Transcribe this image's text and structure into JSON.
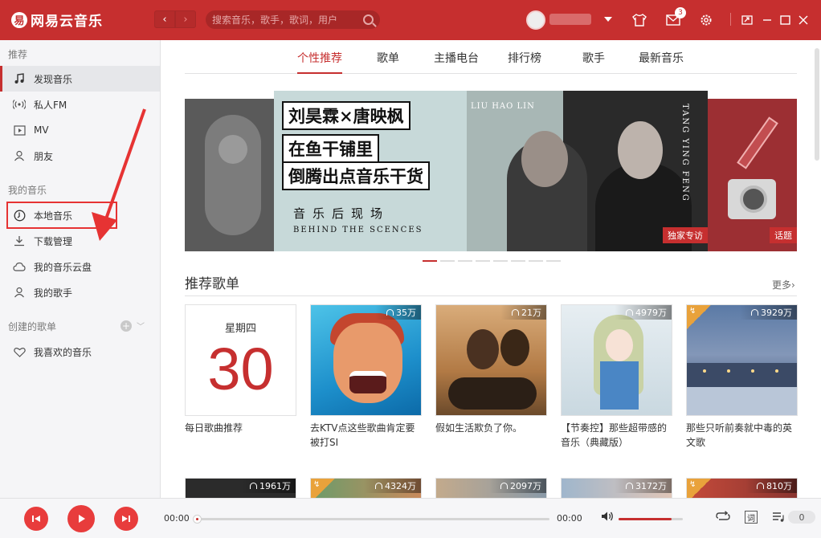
{
  "app": {
    "logo_mark": "易",
    "title": "网易云音乐"
  },
  "header": {
    "back_glyph": "‹",
    "forward_glyph": "›",
    "search_placeholder": "搜索音乐，歌手，歌词，用户",
    "mail_badge": "3",
    "icons": [
      "user-avatar",
      "caret-down-icon",
      "skin-icon",
      "mail-icon",
      "gear-icon",
      "mini-mode-icon",
      "minimize-icon",
      "maximize-icon",
      "close-icon"
    ],
    "accent_color": "#c62f2f"
  },
  "sidebar": {
    "sections": {
      "recommend": "推荐",
      "my_music": "我的音乐",
      "created_playlists": "创建的歌单"
    },
    "recommend_items": [
      {
        "label": "发现音乐",
        "icon": "music-note-icon",
        "active": true
      },
      {
        "label": "私人FM",
        "icon": "radio-icon",
        "active": false
      },
      {
        "label": "MV",
        "icon": "video-icon",
        "active": false
      },
      {
        "label": "朋友",
        "icon": "friends-icon",
        "active": false
      }
    ],
    "my_music_items": [
      {
        "label": "本地音乐",
        "icon": "local-music-icon"
      },
      {
        "label": "下载管理",
        "icon": "download-icon"
      },
      {
        "label": "我的音乐云盘",
        "icon": "cloud-icon"
      },
      {
        "label": "我的歌手",
        "icon": "singer-icon"
      }
    ],
    "playlist_items": [
      {
        "label": "我喜欢的音乐",
        "icon": "heart-icon"
      }
    ]
  },
  "tabs": [
    {
      "label": "个性推荐",
      "active": true
    },
    {
      "label": "歌单",
      "active": false
    },
    {
      "label": "主播电台",
      "active": false
    },
    {
      "label": "排行榜",
      "active": false
    },
    {
      "label": "歌手",
      "active": false
    },
    {
      "label": "最新音乐",
      "active": false
    }
  ],
  "banner": {
    "lines": [
      "刘昊霖×唐映枫",
      "在鱼干铺里",
      "倒腾出点音乐干货"
    ],
    "subtitle": "音乐后现场",
    "subtitle_en": "BEHIND THE SCENCES",
    "label_top": "LIU HAO LIN",
    "label_vertical": "TANG YING FENG",
    "tag": "独家专访",
    "right_tag": "话题",
    "dot_count": 8,
    "active_dot": 0
  },
  "recommend": {
    "title": "推荐歌单",
    "more": "更多›",
    "daily": {
      "weekday": "星期四",
      "day": "30",
      "title": "每日歌曲推荐"
    },
    "cards": [
      {
        "plays": "35万",
        "title": "去KTV点这些歌曲肯定要被打SI"
      },
      {
        "plays": "21万",
        "title": "假如生活欺负了你。"
      },
      {
        "plays": "4979万",
        "title": "【节奏控】那些超带感的音乐（典藏版）"
      },
      {
        "plays": "3929万",
        "title": "那些只听前奏就中毒的英文歌",
        "corner_tag": "↯"
      }
    ],
    "row2_plays": [
      "1961万",
      "4324万",
      "2097万",
      "3172万",
      "810万"
    ]
  },
  "player": {
    "current_time": "00:00",
    "total_time": "00:00",
    "progress": 0,
    "volume": 0.82,
    "lyric_label": "词",
    "queue_count": "0",
    "icons": [
      "prev-icon",
      "play-icon",
      "next-icon",
      "volume-icon",
      "loop-icon",
      "lyric-icon",
      "playlist-icon"
    ]
  }
}
